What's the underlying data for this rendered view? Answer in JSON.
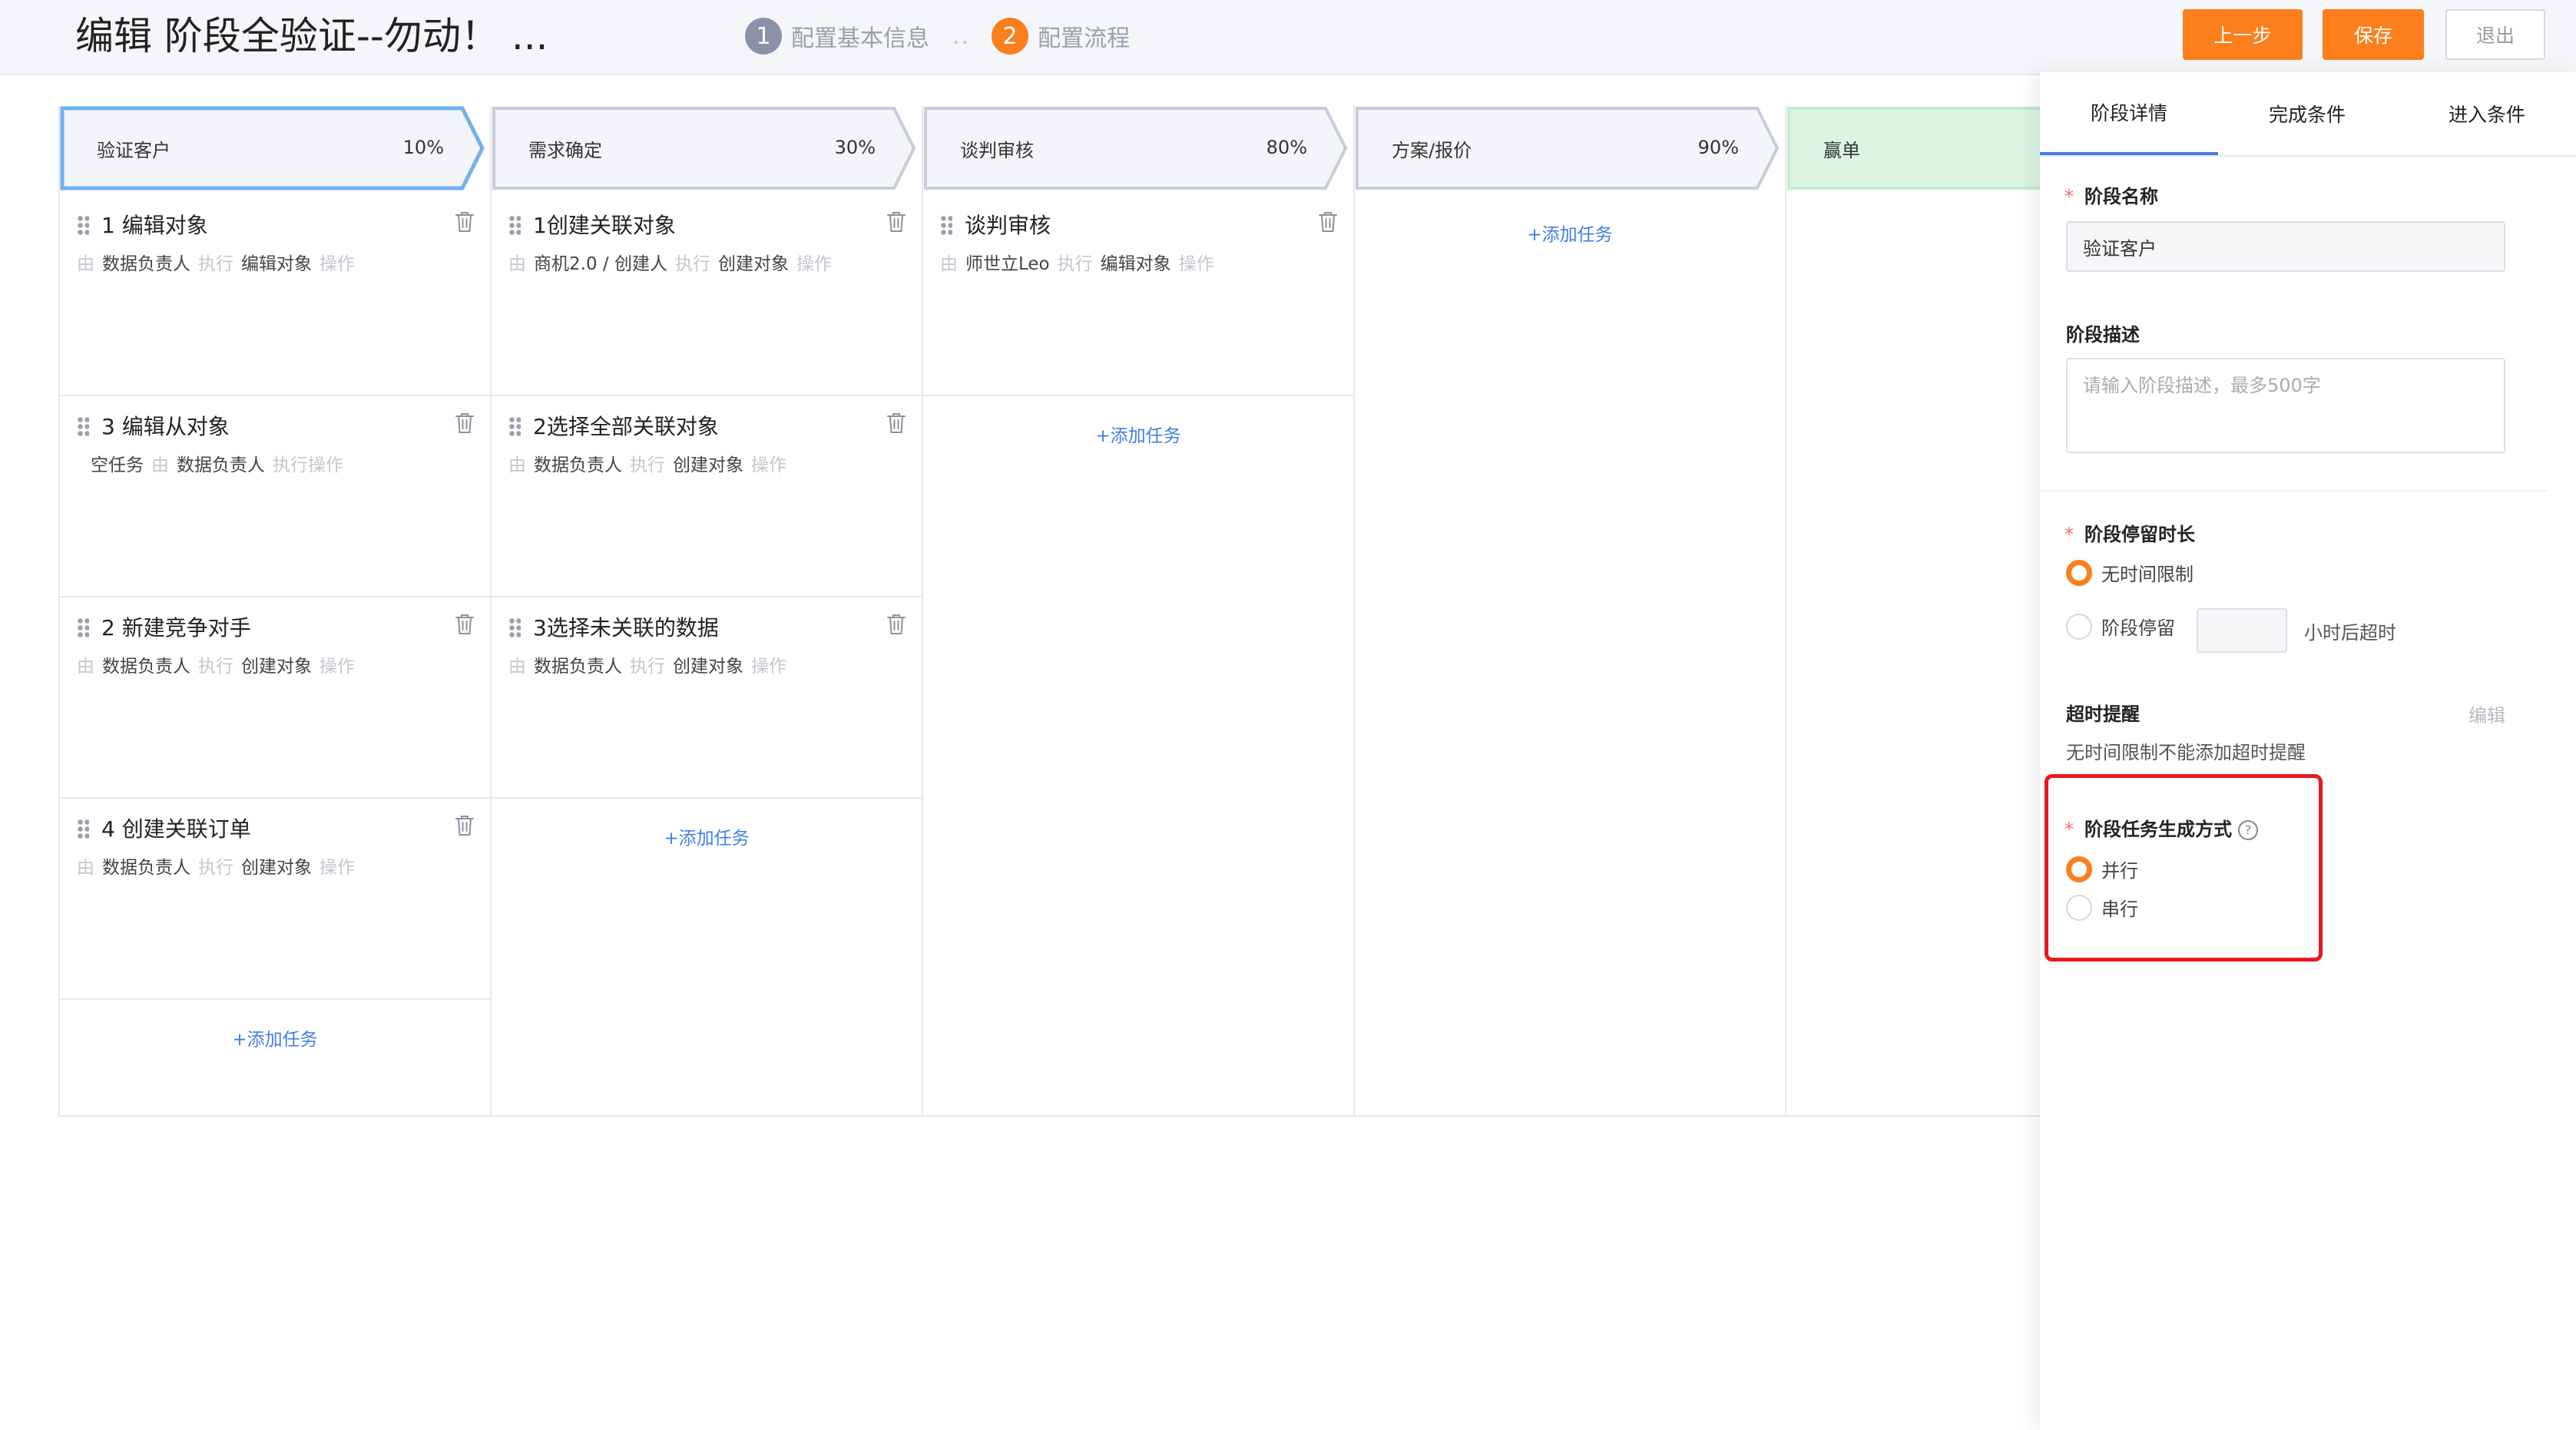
{
  "header": {
    "title": "编辑 阶段全验证--勿动！ ...",
    "steps": [
      {
        "num": "1",
        "label": "配置基本信息",
        "color": "#8a92a8"
      },
      {
        "num": "2",
        "label": "配置流程",
        "color": "#fb7f1c"
      }
    ],
    "step_separator": "..",
    "buttons": {
      "prev": "上一步",
      "save": "保存",
      "exit": "退出"
    }
  },
  "stages": [
    {
      "name": "验证客户",
      "percent": "10%"
    },
    {
      "name": "需求确定",
      "percent": "30%"
    },
    {
      "name": "谈判审核",
      "percent": "80%"
    },
    {
      "name": "方案/报价",
      "percent": "90%"
    },
    {
      "name": "赢单",
      "percent": ""
    }
  ],
  "columns": [
    {
      "tasks": [
        {
          "title": "1 编辑对象",
          "by": "由",
          "owner": "数据负责人",
          "exec": "执行",
          "action": "编辑对象",
          "op": "操作"
        },
        {
          "title": "3 编辑从对象",
          "by": "空任务",
          "owner": "由",
          "exec": "数据负责人",
          "action": "执行操作",
          "op": ""
        },
        {
          "title": "2 新建竞争对手",
          "by": "由",
          "owner": "数据负责人",
          "exec": "执行",
          "action": "创建对象",
          "op": "操作"
        },
        {
          "title": "4 创建关联订单",
          "by": "由",
          "owner": "数据负责人",
          "exec": "执行",
          "action": "创建对象",
          "op": "操作"
        }
      ]
    },
    {
      "tasks": [
        {
          "title": "1创建关联对象",
          "by": "由",
          "owner": "商机2.0 / 创建人",
          "exec": "执行",
          "action": "创建对象",
          "op": "操作"
        },
        {
          "title": "2选择全部关联对象",
          "by": "由",
          "owner": "数据负责人",
          "exec": "执行",
          "action": "创建对象",
          "op": "操作"
        },
        {
          "title": "3选择未关联的数据",
          "by": "由",
          "owner": "数据负责人",
          "exec": "执行",
          "action": "创建对象",
          "op": "操作"
        }
      ]
    },
    {
      "tasks": [
        {
          "title": "谈判审核",
          "by": "由",
          "owner": "师世立Leo",
          "exec": "执行",
          "action": "编辑对象",
          "op": "操作"
        }
      ]
    },
    {
      "tasks": []
    },
    {
      "tasks": []
    }
  ],
  "add_task_label": "+添加任务",
  "panel": {
    "tabs": [
      "阶段详情",
      "完成条件",
      "进入条件"
    ],
    "name_label": "阶段名称",
    "name_value": "验证客户",
    "desc_label": "阶段描述",
    "desc_placeholder": "请输入阶段描述，最多500字",
    "stay_label": "阶段停留时长",
    "stay_opt1": "无时间限制",
    "stay_opt2": "阶段停留",
    "stay_suffix": "小时后超时",
    "timeout_label": "超时提醒",
    "timeout_edit": "编辑",
    "timeout_note": "无时间限制不能添加超时提醒",
    "gen_label": "阶段任务生成方式",
    "gen_help": "?",
    "gen_opt1": "并行",
    "gen_opt2": "串行",
    "required_mark": "*"
  },
  "colors": {
    "accent": "#fb7f1c",
    "link": "#3f7fe5",
    "active_stage": "#6fb2f0",
    "won_stage": "#dcf5e3",
    "highlight": "#e8181e"
  }
}
